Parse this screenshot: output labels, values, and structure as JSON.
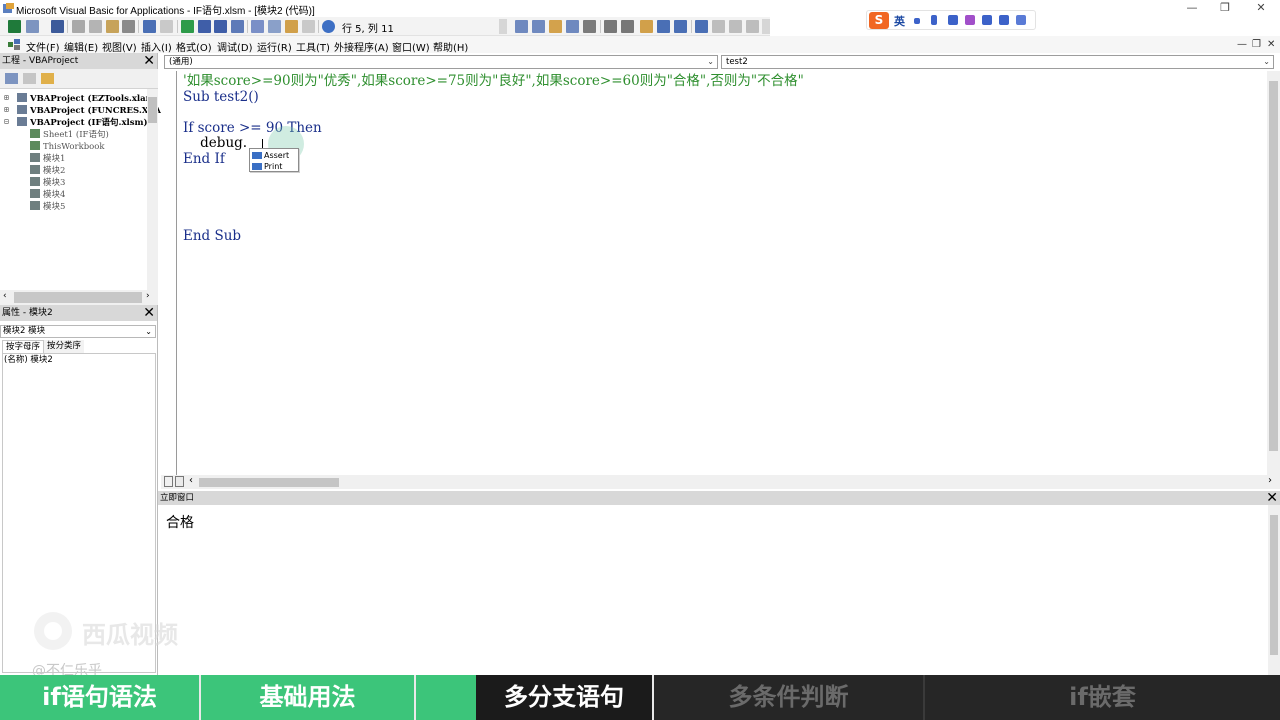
{
  "window": {
    "title": "Microsoft Visual Basic for Applications - IF语句.xlsm - [模块2 (代码)]"
  },
  "toolbar": {
    "position_readout": "行 5, 列 11"
  },
  "ime": {
    "logo": "S",
    "lang": "英"
  },
  "menu": {
    "items": [
      "文件(F)",
      "编辑(E)",
      "视图(V)",
      "插入(I)",
      "格式(O)",
      "调试(D)",
      "运行(R)",
      "工具(T)",
      "外接程序(A)",
      "窗口(W)",
      "帮助(H)"
    ]
  },
  "project_pane": {
    "title": "工程 - VBAProject",
    "tree": [
      {
        "label": "VBAProject (EZTools.xlam)",
        "bold": true
      },
      {
        "label": "VBAProject (FUNCRES.XLAM)",
        "bold": true
      },
      {
        "label": "VBAProject (IF语句.xlsm)",
        "bold": true
      },
      {
        "label": "Sheet1 (IF语句)",
        "bold": false
      },
      {
        "label": "ThisWorkbook",
        "bold": false
      },
      {
        "label": "模块1",
        "bold": false
      },
      {
        "label": "模块2",
        "bold": false
      },
      {
        "label": "模块3",
        "bold": false
      },
      {
        "label": "模块4",
        "bold": false
      },
      {
        "label": "模块5",
        "bold": false
      }
    ]
  },
  "properties_pane": {
    "title": "属性 - 模块2",
    "select_value": "模块2 模块",
    "tabs": [
      "按字母序",
      "按分类序"
    ],
    "row_name": "(名称)",
    "row_value": "模块2"
  },
  "code_window": {
    "object_combo": "(通用)",
    "proc_combo": "test2",
    "lines": [
      {
        "text": "'如果score>=90则为\"优秀\",如果score>=75则为\"良好\",如果score>=60则为\"合格\",否则为\"不合格\"",
        "color": "#2f8f2f"
      },
      {
        "text": "Sub test2()",
        "color": "#1a2f8a"
      },
      {
        "text": "",
        "color": "#000000"
      },
      {
        "text": "If score >= 90 Then",
        "color": "#1a2f8a"
      },
      {
        "text": "    debug.",
        "color": "#000000"
      },
      {
        "text": "End If",
        "color": "#1a2f8a"
      },
      {
        "text": "",
        "color": "#000000"
      },
      {
        "text": "",
        "color": "#000000"
      },
      {
        "text": "",
        "color": "#000000"
      },
      {
        "text": "",
        "color": "#000000"
      },
      {
        "text": "End Sub",
        "color": "#1a2f8a"
      }
    ]
  },
  "autocomplete": {
    "items": [
      "Assert",
      "Print"
    ]
  },
  "immediate_window": {
    "title": "立即窗口",
    "output": "合格"
  },
  "overlay": {
    "watermark": "西瓜视频",
    "author": "@不仁乐乎"
  },
  "chapters": [
    {
      "label": "if语句语法",
      "state": "done"
    },
    {
      "label": "基础用法",
      "state": "done"
    },
    {
      "label": "",
      "state": "done"
    },
    {
      "label": "多分支语句",
      "state": "current"
    },
    {
      "label": "多条件判断",
      "state": "future"
    },
    {
      "label": "if嵌套",
      "state": "future"
    }
  ],
  "colors": {
    "comment": "#2f8f2f",
    "keyword": "#1a2f8a",
    "chapter_done": "#3cc57a",
    "ime_brand": "#f16622"
  }
}
